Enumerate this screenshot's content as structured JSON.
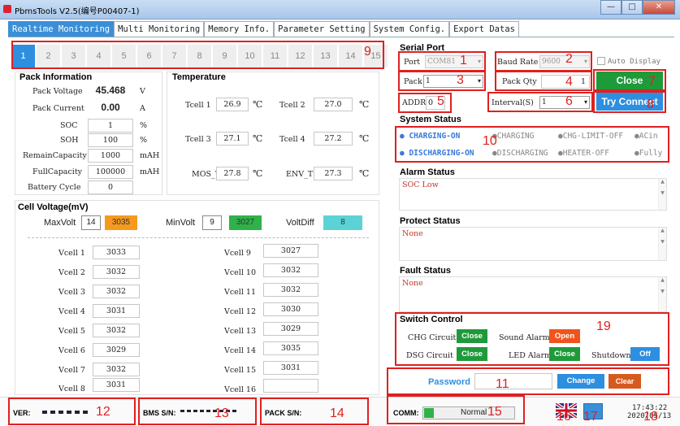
{
  "window": {
    "title": "PbmsTools V2.5(编号P00407-1)",
    "minimize": "—",
    "maximize": "□",
    "close": "✕"
  },
  "tabs": [
    "Realtime Monitoring",
    "Multi Monitoring",
    "Memory Info.",
    "Parameter Setting",
    "System Config.",
    "Export Datas"
  ],
  "pager": [
    "1",
    "2",
    "3",
    "4",
    "5",
    "6",
    "7",
    "8",
    "9",
    "10",
    "11",
    "12",
    "13",
    "14",
    "15"
  ],
  "pack": {
    "title": "Pack Information",
    "voltage_label": "Pack Voltage",
    "voltage": "45.468",
    "voltage_unit": "V",
    "current_label": "Pack Current",
    "current": "0.00",
    "current_unit": "A",
    "soc_label": "SOC",
    "soc": "1",
    "soc_unit": "%",
    "soh_label": "SOH",
    "soh": "100",
    "soh_unit": "%",
    "remain_label": "RemainCapacity",
    "remain": "1000",
    "remain_unit": "mAH",
    "full_label": "FullCapacity",
    "full": "100000",
    "full_unit": "mAH",
    "cycle_label": "Battery Cycle",
    "cycle": "0"
  },
  "temperature": {
    "title": "Temperature",
    "unit": "℃",
    "tcell1_label": "Tcell 1",
    "tcell1": "26.9",
    "tcell2_label": "Tcell 2",
    "tcell2": "27.0",
    "tcell3_label": "Tcell 3",
    "tcell3": "27.1",
    "tcell4_label": "Tcell 4",
    "tcell4": "27.2",
    "mos_label": "MOS_T",
    "mos": "27.8",
    "env_label": "ENV_T",
    "env": "27.3"
  },
  "cells": {
    "title": "Cell Voltage(mV)",
    "max_label": "MaxVolt",
    "max_idx": "14",
    "max_val": "3035",
    "min_label": "MinVolt",
    "min_idx": "9",
    "min_val": "3027",
    "diff_label": "VoltDiff",
    "diff_val": "8",
    "left": [
      {
        "label": "Vcell 1",
        "value": "3033"
      },
      {
        "label": "Vcell 2",
        "value": "3032"
      },
      {
        "label": "Vcell 3",
        "value": "3032"
      },
      {
        "label": "Vcell 4",
        "value": "3031"
      },
      {
        "label": "Vcell 5",
        "value": "3032"
      },
      {
        "label": "Vcell 6",
        "value": "3029"
      },
      {
        "label": "Vcell 7",
        "value": "3032"
      },
      {
        "label": "Vcell 8",
        "value": "3031"
      }
    ],
    "right": [
      {
        "label": "Vcell 9",
        "value": "3027"
      },
      {
        "label": "Vcell 10",
        "value": "3032"
      },
      {
        "label": "Vcell 11",
        "value": "3032"
      },
      {
        "label": "Vcell 12",
        "value": "3030"
      },
      {
        "label": "Vcell 13",
        "value": "3029"
      },
      {
        "label": "Vcell 14",
        "value": "3035"
      },
      {
        "label": "Vcell 15",
        "value": "3031"
      },
      {
        "label": "Vcell 16",
        "value": ""
      }
    ]
  },
  "serial": {
    "title": "Serial Port",
    "port_label": "Port",
    "port": "COM81",
    "baud_label": "Baud Rate",
    "baud": "9600",
    "auto_display": "Auto Display",
    "pack_label": "Pack",
    "pack": "1",
    "packqty_label": "Pack Qty",
    "packqty": "1",
    "close_btn": "Close",
    "addr_label": "ADDR",
    "addr": "0",
    "interval_label": "Interval(S)",
    "interval": "1",
    "connect_btn": "Try Connect"
  },
  "system_status": {
    "title": "System Status",
    "items": [
      "CHARGING-ON",
      "CHARGING",
      "CHG-LIMIT-OFF",
      "ACin",
      "DISCHARGING-ON",
      "DISCHARGING",
      "HEATER-OFF",
      "Fully"
    ]
  },
  "alarm": {
    "title": "Alarm Status",
    "text": "SOC Low"
  },
  "protect": {
    "title": "Protect Status",
    "text": "None"
  },
  "fault": {
    "title": "Fault Status",
    "text": "None"
  },
  "switch": {
    "title": "Switch Control",
    "chg_label": "CHG Circuit",
    "chg_state": "Close",
    "sound_label": "Sound Alarm",
    "sound_state": "Open",
    "dsg_label": "DSG Circuit",
    "dsg_state": "Close",
    "led_label": "LED Alarm",
    "led_state": "Close",
    "shutdown_label": "Shutdown",
    "shutdown_state": "Off"
  },
  "password": {
    "label": "Password",
    "value": "",
    "change_btn": "Change",
    "clear_btn": "Clear"
  },
  "footer": {
    "ver_label": "VER:",
    "bms_label": "BMS S/N:",
    "pack_label": "PACK S/N:",
    "comm_label": "COMM:",
    "comm_status": "Normal",
    "time": "17:43:22",
    "date": "2020/05/13"
  },
  "annotations": [
    "1",
    "2",
    "3",
    "4",
    "5",
    "6",
    "7",
    "8",
    "9",
    "10",
    "11",
    "12",
    "13",
    "14",
    "15",
    "16",
    "17",
    "18",
    "19"
  ],
  "colors": {
    "accent": "#2d8fe0",
    "green": "#1f9a3a",
    "orange": "#f59a1e",
    "cyan": "#5bd3d6",
    "red_anno": "#e02020"
  }
}
